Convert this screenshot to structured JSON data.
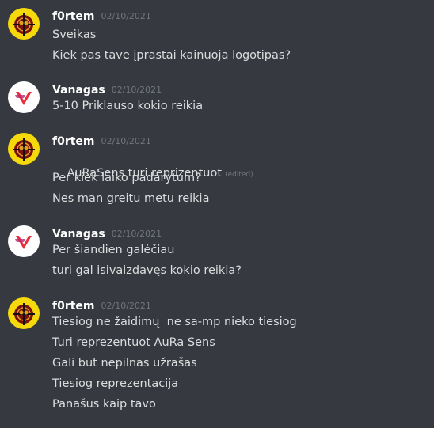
{
  "colors": {
    "background": "#36393f",
    "username": "#ffffff",
    "text": "#dcddde",
    "timestamp": "#72767d"
  },
  "messages": [
    {
      "author": "f0rtem",
      "timestamp": "02/10/2021",
      "avatar_icon": "f0rtem-avatar-icon",
      "lines": [
        "Sveikas",
        "Kiek pas tave įprastai kainuoja logotipas?"
      ]
    },
    {
      "author": "Vanagas",
      "timestamp": "02/10/2021",
      "avatar_icon": "vanagas-avatar-icon",
      "lines": [
        "5-10 Priklauso kokio reikia"
      ]
    },
    {
      "author": "f0rtem",
      "timestamp": "02/10/2021",
      "avatar_icon": "f0rtem-avatar-icon",
      "lines": [
        "AuRaSens turi reprizentuot",
        "Per kiek laiko padarytum?",
        "Nes man greitu metu reikia"
      ],
      "edited_label": "(edited)"
    },
    {
      "author": "Vanagas",
      "timestamp": "02/10/2021",
      "avatar_icon": "vanagas-avatar-icon",
      "lines": [
        "Per šiandien galėčiau",
        "turi gal isivaizdavęs kokio reikia?"
      ]
    },
    {
      "author": "f0rtem",
      "timestamp": "02/10/2021",
      "avatar_icon": "f0rtem-avatar-icon",
      "lines": [
        "Tiesiog ne žaidimų  ne sa-mp nieko tiesiog",
        "Turi reprezentuot AuRa Sens",
        "Gali būt nepilnas užrašas",
        "Tiesiog reprezentacija",
        "Panašus kaip tavo"
      ]
    }
  ]
}
